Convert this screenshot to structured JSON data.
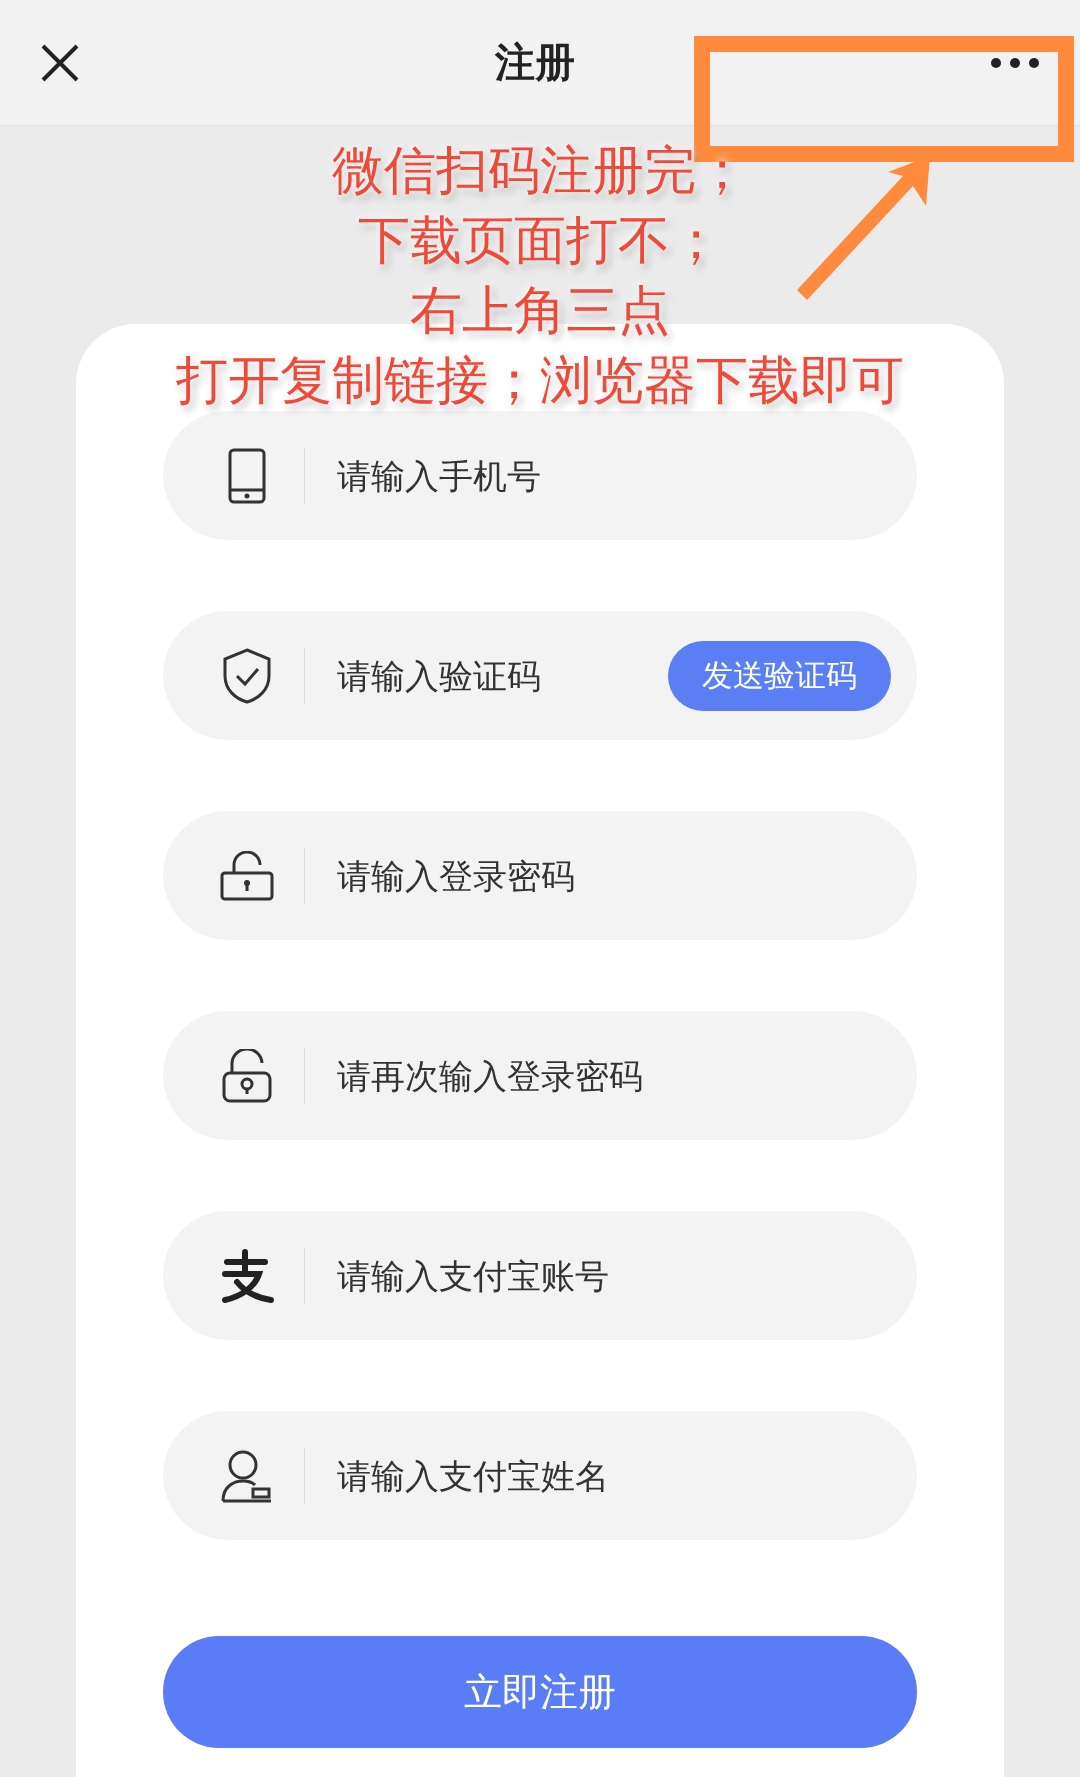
{
  "header": {
    "title": "注册"
  },
  "fields": [
    {
      "kind": "phone",
      "placeholder": "请输入手机号"
    },
    {
      "kind": "code",
      "placeholder": "请输入验证码",
      "action": "发送验证码"
    },
    {
      "kind": "lock",
      "placeholder": "请输入登录密码"
    },
    {
      "kind": "lock2",
      "placeholder": "请再次输入登录密码"
    },
    {
      "kind": "alipay",
      "placeholder": "请输入支付宝账号"
    },
    {
      "kind": "user",
      "placeholder": "请输入支付宝姓名"
    }
  ],
  "submit": "立即注册",
  "annotation": {
    "lines": [
      "微信扫码注册完；",
      "下载页面打不；",
      "右上角三点",
      "打开复制链接；浏览器下载即可"
    ]
  }
}
